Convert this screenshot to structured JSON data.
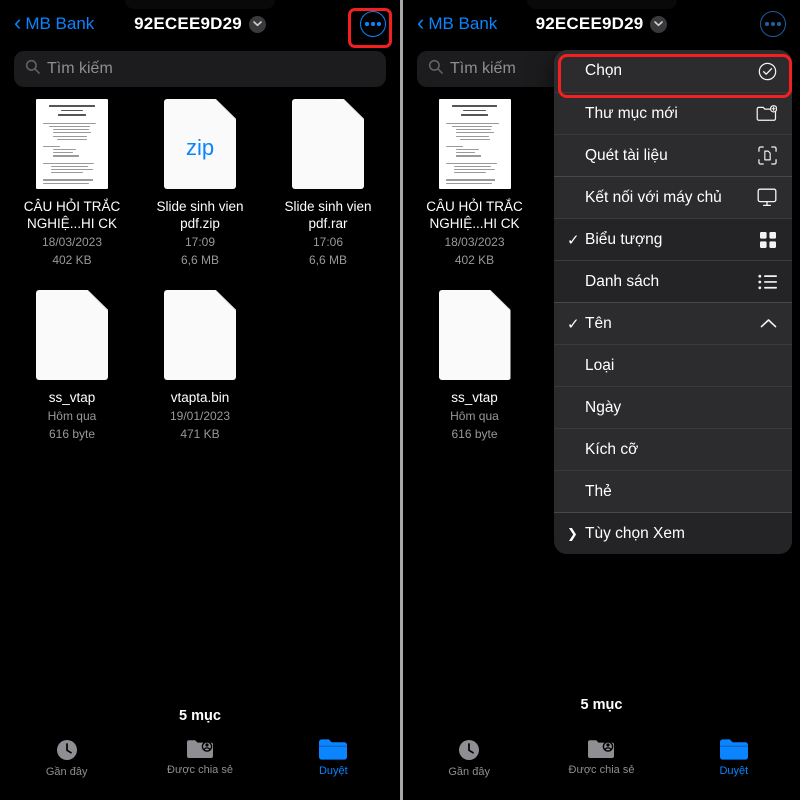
{
  "nav": {
    "back_label": "MB Bank",
    "title": "92ECEE9D29",
    "caret_icon": "chevron-down-icon",
    "more_icon": "ellipsis-circle-icon"
  },
  "search": {
    "placeholder": "Tìm kiếm",
    "icon": "search-icon"
  },
  "files": [
    {
      "name": "CÂU HỎI TRẮC NGHIỆ...HI CK",
      "date": "18/03/2023",
      "size": "402 KB",
      "kind": "document-preview"
    },
    {
      "name": "Slide sinh vien pdf.zip",
      "date": "17:09",
      "size": "6,6 MB",
      "kind": "zip",
      "badge": "zip"
    },
    {
      "name": "Slide sinh vien pdf.rar",
      "date": "17:06",
      "size": "6,6 MB",
      "kind": "blank"
    },
    {
      "name": "ss_vtap",
      "date": "Hôm qua",
      "size": "616 byte",
      "kind": "blank"
    },
    {
      "name": "vtapta.bin",
      "date": "19/01/2023",
      "size": "471 KB",
      "kind": "blank"
    }
  ],
  "footer": {
    "item_count": "5 mục"
  },
  "tabs": [
    {
      "label": "Gần đây",
      "icon": "clock-icon",
      "active": false
    },
    {
      "label": "Được chia sẻ",
      "icon": "shared-folder-person-icon",
      "active": false
    },
    {
      "label": "Duyệt",
      "icon": "folder-icon",
      "active": true
    }
  ],
  "context_menu": {
    "items": [
      {
        "label": "Chọn",
        "icon": "checkmark-circle-icon",
        "checked": false,
        "arrow": false,
        "highlighted": true
      },
      {
        "label": "Thư mục mới",
        "icon": "folder-badge-plus-icon",
        "checked": false,
        "arrow": false,
        "highlighted": false
      },
      {
        "label": "Quét tài liệu",
        "icon": "document-scanner-icon",
        "checked": false,
        "arrow": false,
        "highlighted": false
      },
      {
        "label": "Kết nối với máy chủ",
        "icon": "display-icon",
        "checked": false,
        "arrow": false,
        "highlighted": false
      },
      {
        "label": "Biểu tượng",
        "icon": "grid-icon",
        "checked": true,
        "arrow": false,
        "highlighted": false
      },
      {
        "label": "Danh sách",
        "icon": "list-icon",
        "checked": false,
        "arrow": false,
        "highlighted": false
      },
      {
        "label": "Tên",
        "icon": "chevron-up-icon",
        "checked": true,
        "arrow": false,
        "highlighted": false
      },
      {
        "label": "Loại",
        "icon": "",
        "checked": false,
        "arrow": false,
        "highlighted": false
      },
      {
        "label": "Ngày",
        "icon": "",
        "checked": false,
        "arrow": false,
        "highlighted": false
      },
      {
        "label": "Kích cỡ",
        "icon": "",
        "checked": false,
        "arrow": false,
        "highlighted": false
      },
      {
        "label": "Thẻ",
        "icon": "",
        "checked": false,
        "arrow": false,
        "highlighted": false
      },
      {
        "label": "Tùy chọn Xem",
        "icon": "",
        "checked": false,
        "arrow": true,
        "highlighted": false
      }
    ]
  },
  "colors": {
    "accent": "#0a84ff",
    "highlight": "#f42020",
    "menu_bg": "#2c2c2e",
    "secondary_text": "#98989d"
  }
}
